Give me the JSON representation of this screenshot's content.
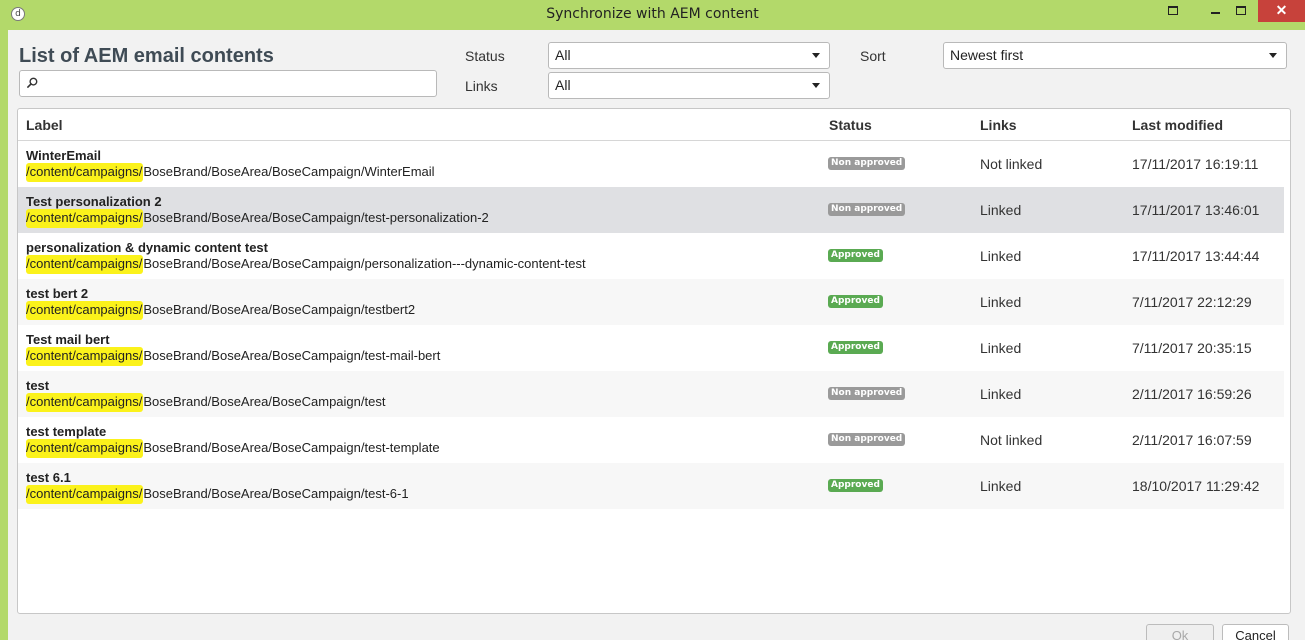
{
  "window": {
    "title": "Synchronize with AEM content",
    "app_icon_glyph": "d",
    "close_glyph": "✕"
  },
  "header": {
    "title": "List of AEM email contents",
    "search": {
      "value": "",
      "placeholder": ""
    }
  },
  "filters": {
    "status_label": "Status",
    "status_value": "All",
    "links_label": "Links",
    "links_value": "All",
    "sort_label": "Sort",
    "sort_value": "Newest first"
  },
  "table": {
    "columns": [
      "Label",
      "Status",
      "Links",
      "Last modified"
    ],
    "path_prefix": "/content/campaigns/",
    "rows": [
      {
        "name": "WinterEmail",
        "path_rest": "BoseBrand/BoseArea/BoseCampaign/WinterEmail",
        "status": "Non approved",
        "links": "Not linked",
        "modified": "17/11/2017 16:19:11"
      },
      {
        "name": "Test personalization 2",
        "path_rest": "BoseBrand/BoseArea/BoseCampaign/test-personalization-2",
        "status": "Non approved",
        "links": "Linked",
        "modified": "17/11/2017 13:46:01"
      },
      {
        "name": "personalization & dynamic content test",
        "path_rest": "BoseBrand/BoseArea/BoseCampaign/personalization---dynamic-content-test",
        "status": "Approved",
        "links": "Linked",
        "modified": "17/11/2017 13:44:44"
      },
      {
        "name": "test bert 2",
        "path_rest": "BoseBrand/BoseArea/BoseCampaign/testbert2",
        "status": "Approved",
        "links": "Linked",
        "modified": "7/11/2017 22:12:29"
      },
      {
        "name": "Test mail bert",
        "path_rest": "BoseBrand/BoseArea/BoseCampaign/test-mail-bert",
        "status": "Approved",
        "links": "Linked",
        "modified": "7/11/2017 20:35:15"
      },
      {
        "name": "test",
        "path_rest": "BoseBrand/BoseArea/BoseCampaign/test",
        "status": "Non approved",
        "links": "Linked",
        "modified": "2/11/2017 16:59:26"
      },
      {
        "name": "test template",
        "path_rest": "BoseBrand/BoseArea/BoseCampaign/test-template",
        "status": "Non approved",
        "links": "Not linked",
        "modified": "2/11/2017 16:07:59"
      },
      {
        "name": "test 6.1",
        "path_rest": "BoseBrand/BoseArea/BoseCampaign/test-6-1",
        "status": "Approved",
        "links": "Linked",
        "modified": "18/10/2017 11:29:42"
      }
    ]
  },
  "buttons": {
    "ok": "Ok",
    "cancel": "Cancel"
  },
  "colors": {
    "frame": "#b3d96a",
    "approved": "#5aaa52",
    "non_approved": "#9a9a9a",
    "highlight": "#fbf21b",
    "close": "#c7423b"
  },
  "icons": {
    "app": "app-logo-icon",
    "search": "search-icon",
    "dropdown": "chevron-down-icon"
  }
}
